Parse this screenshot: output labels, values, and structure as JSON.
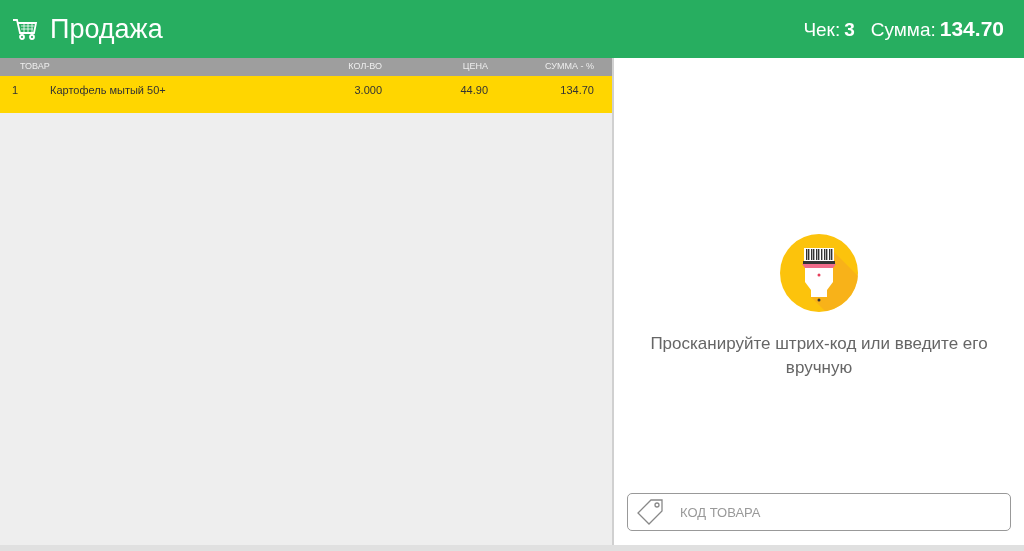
{
  "header": {
    "title": "Продажа",
    "receipt_label": "Чек:",
    "receipt_value": "3",
    "total_label": "Сумма:",
    "total_value": "134.70"
  },
  "table": {
    "columns": [
      "ТОВАР",
      "КОЛ-ВО",
      "ЦЕНА",
      "СУММА - %"
    ],
    "rows": [
      {
        "number": "1",
        "name": "Картофель мытый 50+",
        "quantity": "3.000",
        "price": "44.90",
        "sum": "134.70",
        "selected": true
      }
    ]
  },
  "scan_prompt": "Просканируйте штрих-код или введите его вручную",
  "code_field": {
    "placeholder": "КОД ТОВАРА"
  }
}
